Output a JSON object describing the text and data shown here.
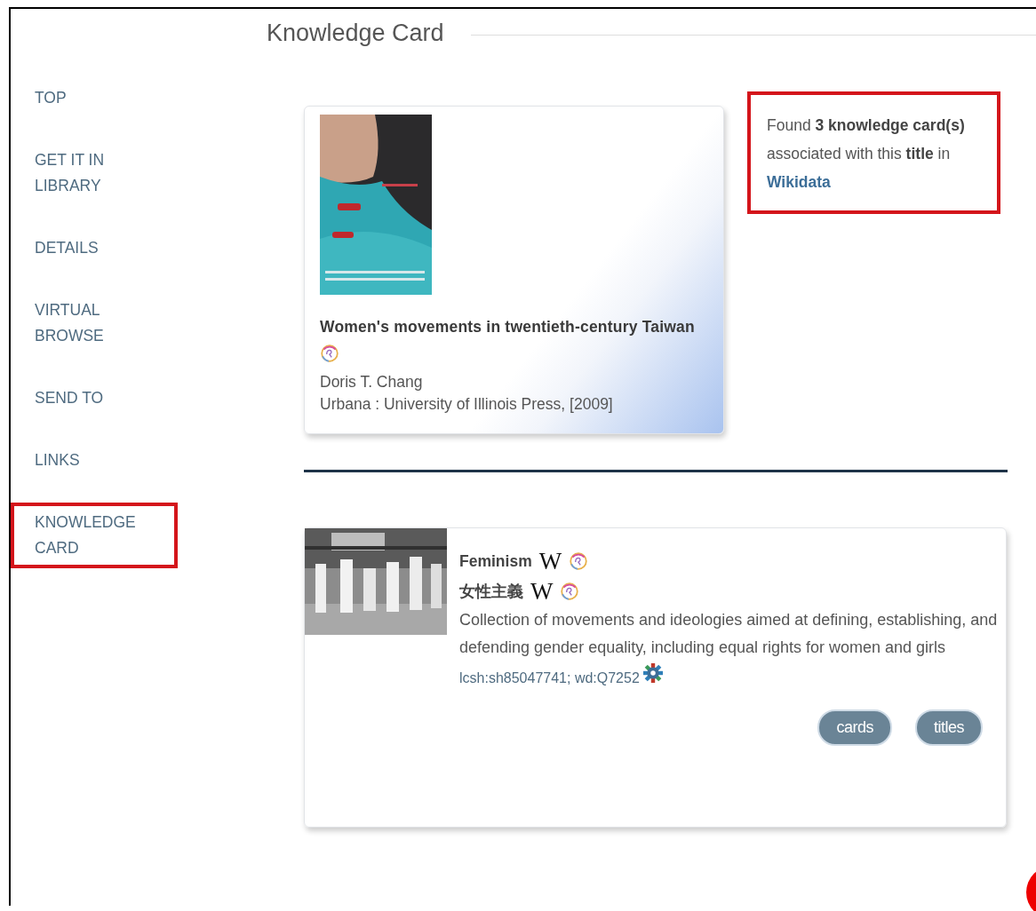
{
  "sidebar": {
    "items": [
      {
        "label": "TOP",
        "highlighted": false
      },
      {
        "label": "GET IT IN LIBRARY",
        "highlighted": false
      },
      {
        "label": "DETAILS",
        "highlighted": false
      },
      {
        "label": "VIRTUAL BROWSE",
        "highlighted": false
      },
      {
        "label": "SEND TO",
        "highlighted": false
      },
      {
        "label": "LINKS",
        "highlighted": false
      },
      {
        "label": "KNOWLEDGE CARD",
        "highlighted": true
      }
    ]
  },
  "section": {
    "heading": "Knowledge Card"
  },
  "book_card": {
    "title": "Women's movements in twentieth-century Taiwan",
    "author": "Doris T. Chang",
    "publisher": "Urbana : University of Illinois Press, [2009]"
  },
  "found_note": {
    "text": "Found **3 knowledge card(s)** associated with this **title** in ",
    "link": "Wikidata",
    "highlighted": true
  },
  "knowledge_cards": [
    {
      "labels": [
        {
          "text": "Feminism",
          "wiki": "W"
        },
        {
          "text": "女性主義",
          "wiki": "W"
        }
      ],
      "description": "Collection of movements and ideologies aimed at defining, establishing, and defending gender equality, including equal rights for women and girls",
      "identifiers": "lcsh:sh85047741; wd:Q7252",
      "buttons": [
        "cards",
        "titles"
      ]
    }
  ]
}
